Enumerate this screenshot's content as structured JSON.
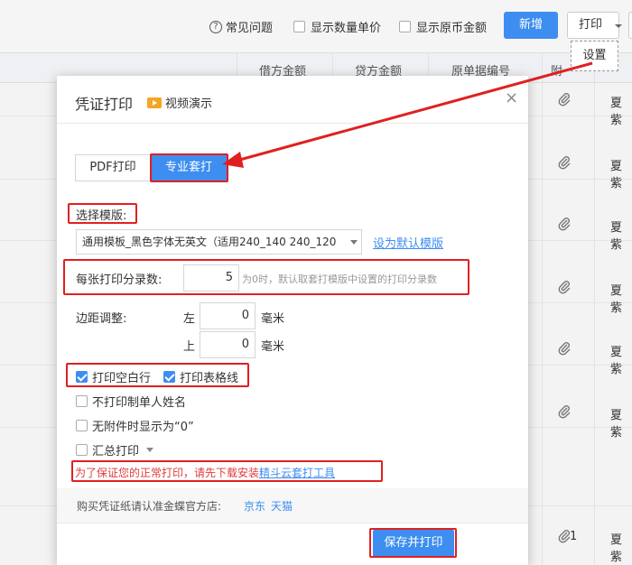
{
  "toolbar": {
    "faq": "常见问题",
    "show_qty_price": "显示数量单价",
    "show_orig_currency": "显示原币金额",
    "new_button": "新增",
    "print_button": "打印",
    "settings_popup": "设置"
  },
  "table": {
    "headers": [
      "借方金额",
      "贷方金额",
      "原单据编号",
      "附件"
    ],
    "header_attach_truncated": "附",
    "row_name": "夏紫",
    "last_row_attach_count": "1"
  },
  "dialog": {
    "title": "凭证打印",
    "video_demo": "视频演示",
    "tabs": [
      "PDF打印",
      "专业套打"
    ],
    "active_tab": "专业套打",
    "template_label": "选择模版:",
    "template_value": "通用模板_黑色字体无英文（适用240_140 240_120",
    "set_default": "设为默认模版",
    "entries_label": "每张打印分录数:",
    "entries_value": "5",
    "entries_hint": "为0时，默认取套打模版中设置的打印分录数",
    "margin_label": "边距调整:",
    "margin_left_label": "左",
    "margin_left_value": "0",
    "margin_top_label": "上",
    "margin_top_value": "0",
    "margin_unit": "毫米",
    "print_blank_rows": "打印空白行",
    "print_grid_lines": "打印表格线",
    "no_maker_name": "不打印制单人姓名",
    "no_attach_show_zero": "无附件时显示为“0”",
    "summary_print": "汇总打印",
    "warning_prefix": "为了保证您的正常打印，请先下载安装",
    "warning_link": "精斗云套打工具",
    "buy_text": "购买凭证纸请认准金蝶官方店:",
    "shop_jd": "京东",
    "shop_tmall": "天猫",
    "save_print": "保存并打印"
  },
  "colors": {
    "primary": "#3d8ef0",
    "annotation_red": "#e02020"
  }
}
